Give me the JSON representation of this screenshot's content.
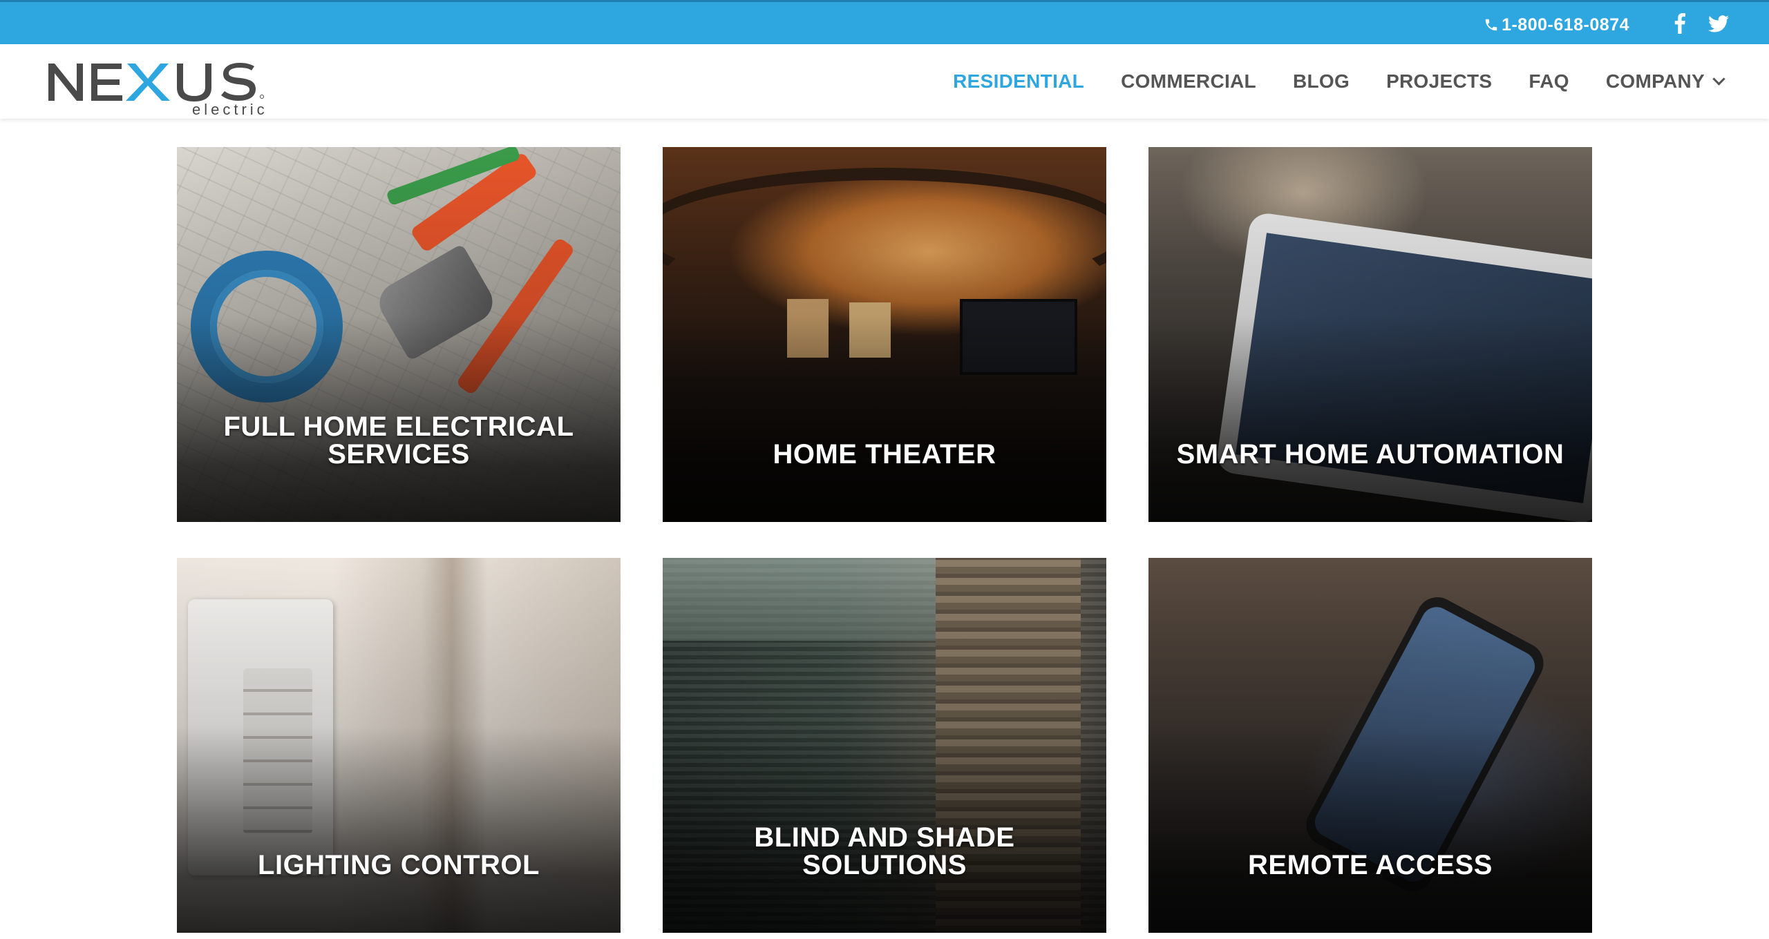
{
  "topbar": {
    "phone": "1-800-618-0874",
    "social": [
      {
        "icon": "facebook-icon"
      },
      {
        "icon": "twitter-icon"
      }
    ],
    "bg_color": "#2ea7e0"
  },
  "header": {
    "logo": {
      "name": "NEXUS",
      "sub": "electric"
    },
    "nav": [
      {
        "label": "RESIDENTIAL",
        "active": true
      },
      {
        "label": "COMMERCIAL",
        "active": false
      },
      {
        "label": "BLOG",
        "active": false
      },
      {
        "label": "PROJECTS",
        "active": false
      },
      {
        "label": "FAQ",
        "active": false
      },
      {
        "label": "COMPANY",
        "active": false,
        "has_dropdown": true
      }
    ],
    "accent_color": "#2ea7e0",
    "nav_color": "#555555"
  },
  "tiles": [
    {
      "label": "FULL HOME ELECTRICAL SERVICES"
    },
    {
      "label": "HOME THEATER"
    },
    {
      "label": "SMART HOME AUTOMATION"
    },
    {
      "label": "LIGHTING CONTROL"
    },
    {
      "label": "BLIND AND SHADE SOLUTIONS"
    },
    {
      "label": "REMOTE ACCESS"
    }
  ]
}
